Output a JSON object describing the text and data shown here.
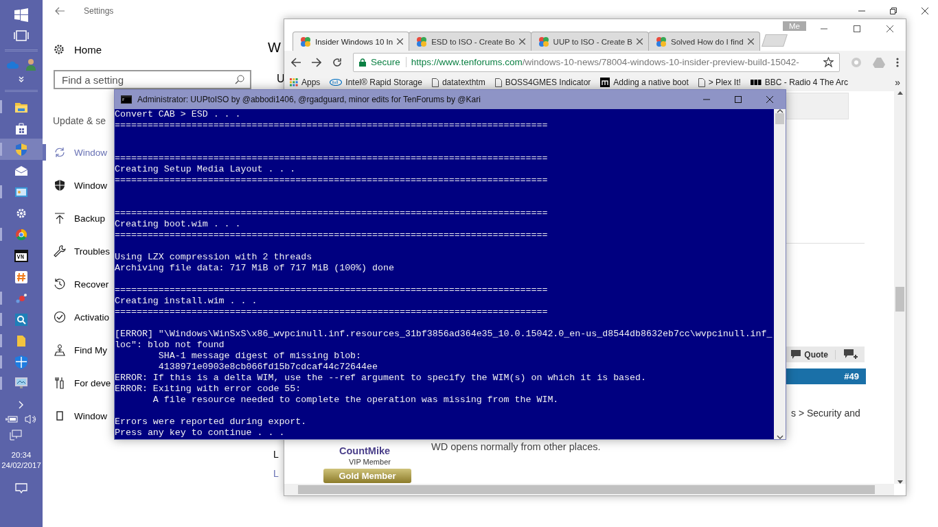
{
  "taskbar": {
    "apps": [
      {
        "running": true,
        "selected": false
      },
      {
        "running": false,
        "selected": false
      },
      {
        "running": true,
        "selected": true
      },
      {
        "running": false,
        "selected": false
      },
      {
        "running": true,
        "selected": false
      },
      {
        "running": false,
        "selected": false
      },
      {
        "running": true,
        "selected": false
      },
      {
        "running": false,
        "selected": false
      },
      {
        "running": false,
        "selected": false
      },
      {
        "running": true,
        "selected": false
      },
      {
        "running": true,
        "selected": false
      },
      {
        "running": true,
        "selected": false
      },
      {
        "running": true,
        "selected": false
      },
      {
        "running": true,
        "selected": false
      }
    ],
    "time": "20:34",
    "date": "24/02/2017"
  },
  "settings": {
    "title": "Settings",
    "home": "Home",
    "search": {
      "placeholder": "Find a setting"
    },
    "section": "Update & se",
    "items": [
      {
        "label": "Window",
        "selected": true
      },
      {
        "label": "Window",
        "selected": false
      },
      {
        "label": "Backup",
        "selected": false
      },
      {
        "label": "Troubles",
        "selected": false
      },
      {
        "label": "Recover",
        "selected": false
      },
      {
        "label": "Activatio",
        "selected": false
      },
      {
        "label": "Find My",
        "selected": false
      },
      {
        "label": "For deve",
        "selected": false
      },
      {
        "label": "Window",
        "selected": false
      }
    ],
    "content_fragments": [
      "W",
      "U",
      "L",
      "L"
    ]
  },
  "browser": {
    "tabs": [
      {
        "label": "Insider Windows 10 In",
        "selected": true
      },
      {
        "label": "ESD to ISO - Create Bo",
        "selected": false
      },
      {
        "label": "UUP to ISO - Create B",
        "selected": false
      },
      {
        "label": "Solved How do I find",
        "selected": false
      }
    ],
    "profile": "Me",
    "secure": "Secure",
    "url_host": "https://www.tenforums.com",
    "url_path": "/windows-10-news/78004-windows-10-insider-preview-build-15042-",
    "bookmarks": [
      "Apps",
      "Intel® Rapid Storage",
      "datatexthtm",
      "BOSS4GMES Indicator",
      "Adding a native boot",
      "> Plex It!",
      "BBC - Radio 4 The Arc"
    ],
    "bookmarks_more": "»",
    "page": {
      "quote": "Quote",
      "post_number": "#49",
      "breadcrumb_fragment": "s > Security and",
      "post_text": "WD opens normally from other places.",
      "user": "CountMike",
      "rank": "VIP Member",
      "badge": "Gold Member"
    }
  },
  "console": {
    "title": "Administrator:  UUPtoISO by @abbodi1406, @rgadguard, minor edits for TenForums by @Kari",
    "output": "Convert CAB > ESD . . .\n===============================================================================\n\n\n===============================================================================\nCreating Setup Media Layout . . .\n===============================================================================\n\n\n===============================================================================\nCreating boot.wim . . .\n===============================================================================\n\nUsing LZX compression with 2 threads\nArchiving file data: 717 MiB of 717 MiB (100%) done\n\n===============================================================================\nCreating install.wim . . .\n===============================================================================\n\n[ERROR] \"\\Windows\\WinSxS\\x86_wvpcinull.inf.resources_31bf3856ad364e35_10.0.15042.0_en-us_d8544db8632eb7cc\\wvpcinull.inf_\nloc\": blob not found\n        SHA-1 message digest of missing blob:\n        4138971e0903e8cb066fd15b7cdcaf44c72644ee\nERROR: If this is a delta WIM, use the --ref argument to specify the WIM(s) on which it is based.\nERROR: Exiting with error code 55:\n       A file resource needed to complete the operation was missing from the WIM.\n\nErrors were reported during export.\nPress any key to continue . . ."
  }
}
